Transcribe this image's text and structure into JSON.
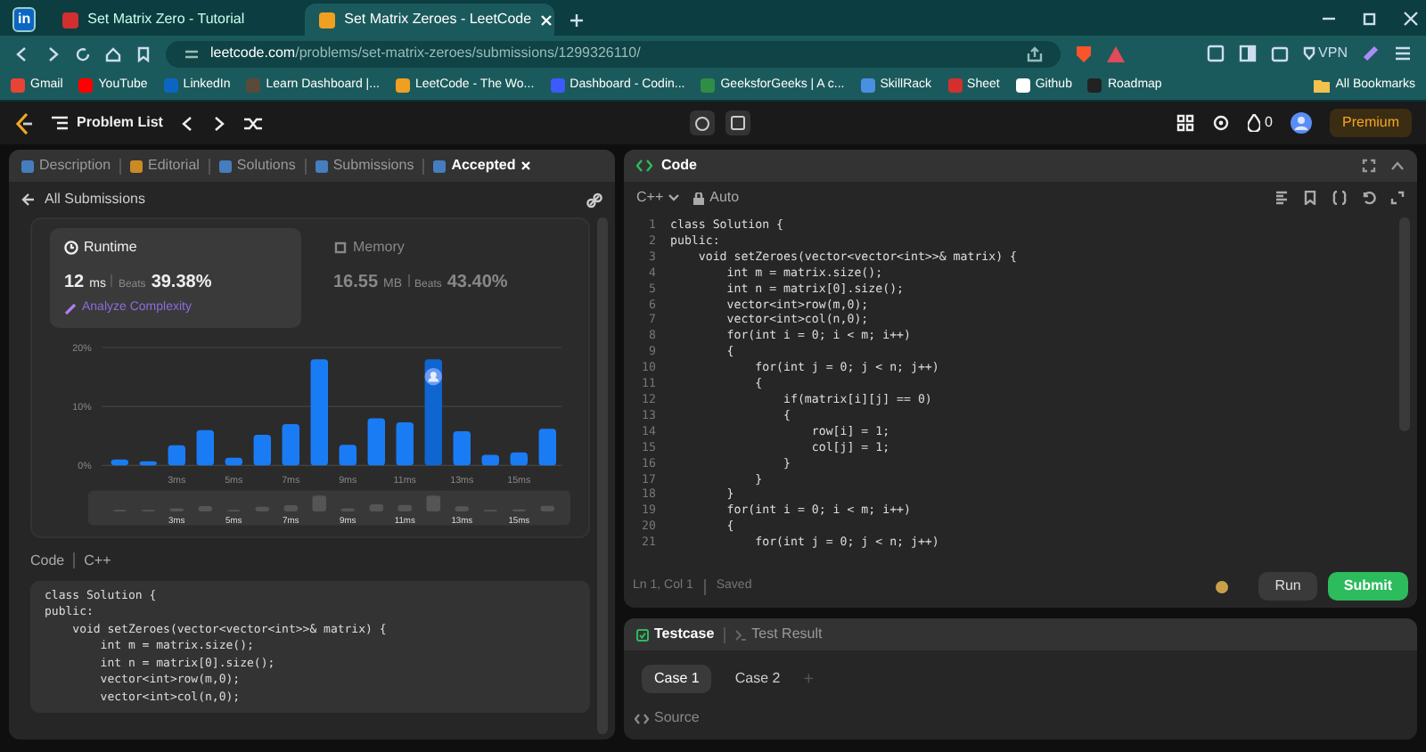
{
  "browser": {
    "tabs": [
      {
        "kind": "pinned",
        "label": "in",
        "selected": false
      },
      {
        "kind": "page",
        "color": "#d32f2f",
        "label": "Set Matrix Zero - Tutorial",
        "selected": false
      },
      {
        "kind": "page",
        "color": "#f0a020",
        "label": "Set Matrix Zeroes - LeetCode",
        "selected": true
      }
    ],
    "address": {
      "domain": "leetcode.com",
      "path": "/problems/set-matrix-zeroes/submissions/1299326110/"
    },
    "vpn_label": "VPN",
    "bookmarks": [
      {
        "label": "Gmail",
        "color": "#ea4335"
      },
      {
        "label": "YouTube",
        "color": "#ff0000"
      },
      {
        "label": "LinkedIn",
        "color": "#0a66c2"
      },
      {
        "label": "Learn Dashboard |...",
        "color": "#5a4a3a"
      },
      {
        "label": "LeetCode - The Wo...",
        "color": "#f0a020"
      },
      {
        "label": "Dashboard - Codin...",
        "color": "#3d5afe"
      },
      {
        "label": "GeeksforGeeks | A c...",
        "color": "#2f8d46"
      },
      {
        "label": "SkillRack",
        "color": "#4a90e2"
      },
      {
        "label": "Sheet",
        "color": "#d32f2f"
      },
      {
        "label": "Github",
        "color": "#ffffff"
      },
      {
        "label": "Roadmap",
        "color": "#222222"
      }
    ],
    "all_bookmarks": "All Bookmarks"
  },
  "nav": {
    "problem_list": "Problem List",
    "streak": "0",
    "premium": "Premium"
  },
  "left": {
    "tabs": [
      {
        "label": "Description",
        "selected": false,
        "closable": false
      },
      {
        "label": "Editorial",
        "selected": false,
        "closable": false
      },
      {
        "label": "Solutions",
        "selected": false,
        "closable": false
      },
      {
        "label": "Submissions",
        "selected": false,
        "closable": false
      },
      {
        "label": "Accepted",
        "selected": true,
        "closable": true
      }
    ],
    "back_label": "All Submissions",
    "stats": [
      {
        "title": "Runtime",
        "value": "12",
        "unit": "ms",
        "beats_label": "Beats",
        "beats": "39.38%",
        "selected": true
      },
      {
        "title": "Memory",
        "value": "16.55",
        "unit": "MB",
        "beats_label": "Beats",
        "beats": "43.40%",
        "selected": false
      }
    ],
    "analyze": "Analyze Complexity",
    "chart_data": {
      "type": "bar",
      "x": [
        1,
        2,
        3,
        4,
        5,
        6,
        7,
        8,
        9,
        10,
        11,
        12,
        13,
        14,
        15,
        16
      ],
      "xlim": [
        0.5,
        16.5
      ],
      "series": [
        {
          "color": "#1a7cf5",
          "values": [
            1,
            0.7,
            3.4,
            6,
            1.3,
            5.2,
            7,
            18,
            3.5,
            8,
            7.3,
            null,
            5.8,
            1.8,
            2.2,
            6.2
          ]
        },
        {
          "color": "#0f66d0",
          "values": [
            null,
            null,
            null,
            null,
            null,
            null,
            null,
            null,
            null,
            null,
            null,
            18,
            null,
            null,
            null,
            null
          ]
        }
      ],
      "ylim": [
        0,
        20
      ],
      "xticks": [
        {
          "value": 3,
          "label": "3ms"
        },
        {
          "value": 5,
          "label": "5ms"
        },
        {
          "value": 7,
          "label": "7ms"
        },
        {
          "value": 9,
          "label": "9ms"
        },
        {
          "value": 11,
          "label": "11ms"
        },
        {
          "value": 13,
          "label": "13ms"
        },
        {
          "value": 15,
          "label": "15ms"
        }
      ],
      "yticks": [
        {
          "value": 0,
          "label": "0%"
        },
        {
          "value": 10,
          "label": "10%"
        },
        {
          "value": 20,
          "label": "20%"
        }
      ]
    },
    "overview_labels": [
      "3ms",
      "5ms",
      "7ms",
      "9ms",
      "11ms",
      "13ms",
      "15ms"
    ],
    "code_label": "Code",
    "language": "C++",
    "code_lines": [
      "class Solution {",
      "public:",
      "    void setZeroes(vector<vector<int>>& matrix) {",
      "        int m = matrix.size();",
      "        int n = matrix[0].size();",
      "        vector<int>row(m,0);",
      "        vector<int>col(n,0);"
    ]
  },
  "right": {
    "title": "Code",
    "language": "C++",
    "mode": "Auto",
    "lines": [
      {
        "number": "1",
        "text": "class Solution {"
      },
      {
        "number": "2",
        "text": "public:"
      },
      {
        "number": "3",
        "text": "    void setZeroes(vector<vector<int>>& matrix) {"
      },
      {
        "number": "4",
        "text": "        int m = matrix.size();"
      },
      {
        "number": "5",
        "text": "        int n = matrix[0].size();"
      },
      {
        "number": "6",
        "text": "        vector<int>row(m,0);"
      },
      {
        "number": "7",
        "text": "        vector<int>col(n,0);"
      },
      {
        "number": "8",
        "text": "        for(int i = 0; i < m; i++)"
      },
      {
        "number": "9",
        "text": "        {"
      },
      {
        "number": "10",
        "text": "            for(int j = 0; j < n; j++)"
      },
      {
        "number": "11",
        "text": "            {"
      },
      {
        "number": "12",
        "text": "                if(matrix[i][j] == 0)"
      },
      {
        "number": "13",
        "text": "                {"
      },
      {
        "number": "14",
        "text": "                    row[i] = 1;"
      },
      {
        "number": "15",
        "text": "                    col[j] = 1;"
      },
      {
        "number": "16",
        "text": "                }"
      },
      {
        "number": "17",
        "text": "            }"
      },
      {
        "number": "18",
        "text": "        }"
      },
      {
        "number": "19",
        "text": "        for(int i = 0; i < m; i++)"
      },
      {
        "number": "20",
        "text": "        {"
      },
      {
        "number": "21",
        "text": "            for(int j = 0; j < n; j++)"
      }
    ],
    "cursor": "Ln 1, Col 1",
    "save_state": "Saved",
    "run": "Run",
    "submit": "Submit"
  },
  "test": {
    "tabs": [
      {
        "label": "Testcase",
        "selected": true
      },
      {
        "label": "Test Result",
        "selected": false
      }
    ],
    "cases": [
      {
        "label": "Case 1",
        "selected": true
      },
      {
        "label": "Case 2",
        "selected": false
      }
    ],
    "add": "+",
    "source": "Source"
  }
}
